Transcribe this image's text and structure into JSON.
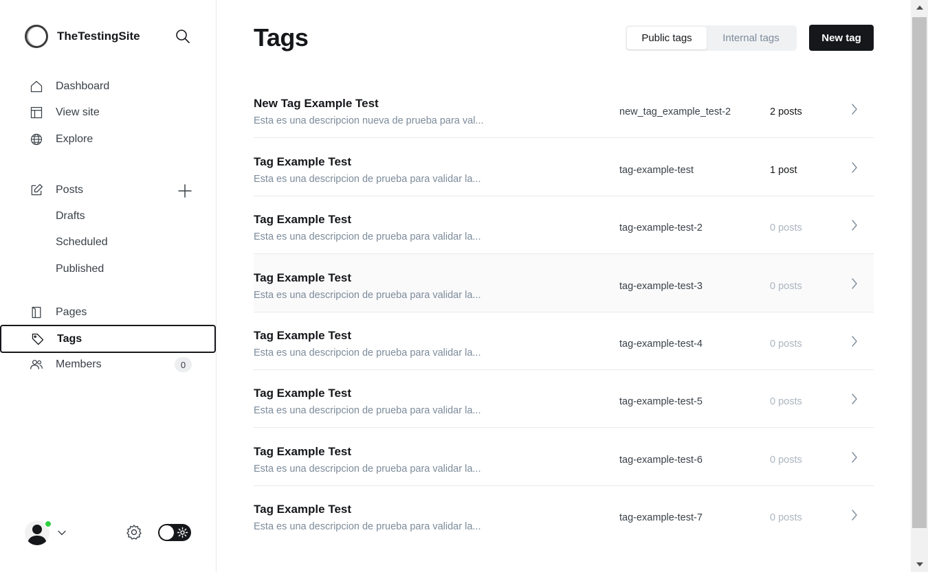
{
  "sidebar": {
    "site_name": "TheTestingSite",
    "nav": {
      "dashboard": "Dashboard",
      "view_site": "View site",
      "explore": "Explore",
      "posts": "Posts",
      "drafts": "Drafts",
      "scheduled": "Scheduled",
      "published": "Published",
      "pages": "Pages",
      "tags": "Tags",
      "members": "Members",
      "members_count": "0"
    },
    "active_item": "tags",
    "online_status_color": "#30cf43"
  },
  "main": {
    "title": "Tags",
    "tabs": {
      "public": "Public tags",
      "internal": "Internal tags",
      "selected": "public"
    },
    "new_tag_label": "New tag",
    "tags": [
      {
        "name": "New Tag Example Test",
        "description": "Esta es una descripcion nueva de prueba para val...",
        "slug": "new_tag_example_test-2",
        "count": "2 posts"
      },
      {
        "name": "Tag Example Test",
        "description": "Esta es una descripcion de prueba para validar la...",
        "slug": "tag-example-test",
        "count": "1 post"
      },
      {
        "name": "Tag Example Test",
        "description": "Esta es una descripcion de prueba para validar la...",
        "slug": "tag-example-test-2",
        "count": "0 posts"
      },
      {
        "name": "Tag Example Test",
        "description": "Esta es una descripcion de prueba para validar la...",
        "slug": "tag-example-test-3",
        "count": "0 posts"
      },
      {
        "name": "Tag Example Test",
        "description": "Esta es una descripcion de prueba para validar la...",
        "slug": "tag-example-test-4",
        "count": "0 posts"
      },
      {
        "name": "Tag Example Test",
        "description": "Esta es una descripcion de prueba para validar la...",
        "slug": "tag-example-test-5",
        "count": "0 posts"
      },
      {
        "name": "Tag Example Test",
        "description": "Esta es una descripcion de prueba para validar la...",
        "slug": "tag-example-test-6",
        "count": "0 posts"
      },
      {
        "name": "Tag Example Test",
        "description": "Esta es una descripcion de prueba para validar la...",
        "slug": "tag-example-test-7",
        "count": "0 posts"
      }
    ]
  },
  "icons": [
    "search-icon",
    "home-icon",
    "layout-icon",
    "globe-icon",
    "edit-icon",
    "plus-icon",
    "page-icon",
    "tag-icon",
    "members-icon",
    "user-icon",
    "chevron-down-icon",
    "gear-icon",
    "sun-icon",
    "chevron-right-icon"
  ]
}
